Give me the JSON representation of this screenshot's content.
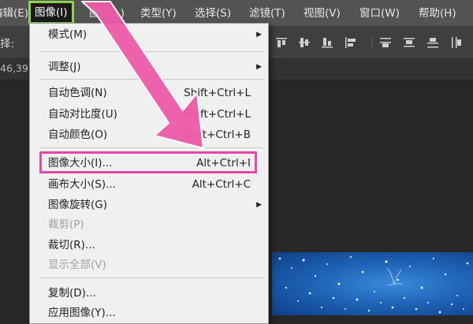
{
  "menubar": {
    "items": [
      {
        "label": "编辑(E)"
      },
      {
        "label": "图像(I)",
        "active": true
      },
      {
        "label": "图层(L)"
      },
      {
        "label": "类型(Y)"
      },
      {
        "label": "选择(S)"
      },
      {
        "label": "滤镜(T)"
      },
      {
        "label": "视图(V)"
      },
      {
        "label": "窗口(W)"
      },
      {
        "label": "帮助(H)"
      }
    ]
  },
  "options_bar": {
    "label": "择:"
  },
  "tab": {
    "text": "46,39"
  },
  "image_menu": {
    "items": [
      {
        "label": "模式(M)",
        "has_submenu": true
      },
      {
        "label": "调整(J)",
        "has_submenu": true
      },
      {
        "label": "自动色调(N)",
        "shortcut": "Shift+Ctrl+L"
      },
      {
        "label": "自动对比度(U)",
        "shortcut": "Shift+Ctrl+L"
      },
      {
        "label": "自动颜色(O)",
        "shortcut": "Shift+Ctrl+B"
      },
      {
        "label": "图像大小(I)...",
        "shortcut": "Alt+Ctrl+I",
        "highlighted": true
      },
      {
        "label": "画布大小(S)...",
        "shortcut": "Alt+Ctrl+C"
      },
      {
        "label": "图像旋转(G)",
        "has_submenu": true
      },
      {
        "label": "裁剪(P)",
        "disabled": true
      },
      {
        "label": "裁切(R)..."
      },
      {
        "label": "显示全部(V)",
        "disabled": true
      },
      {
        "label": "复制(D)..."
      },
      {
        "label": "应用图像(Y)..."
      }
    ]
  },
  "colors": {
    "menubar_bg": "#535353",
    "menu_bg": "#f0f0f0",
    "active_border": "#92d050",
    "highlight_box": "#e24aa8",
    "arrow": "#ee5aa8"
  }
}
